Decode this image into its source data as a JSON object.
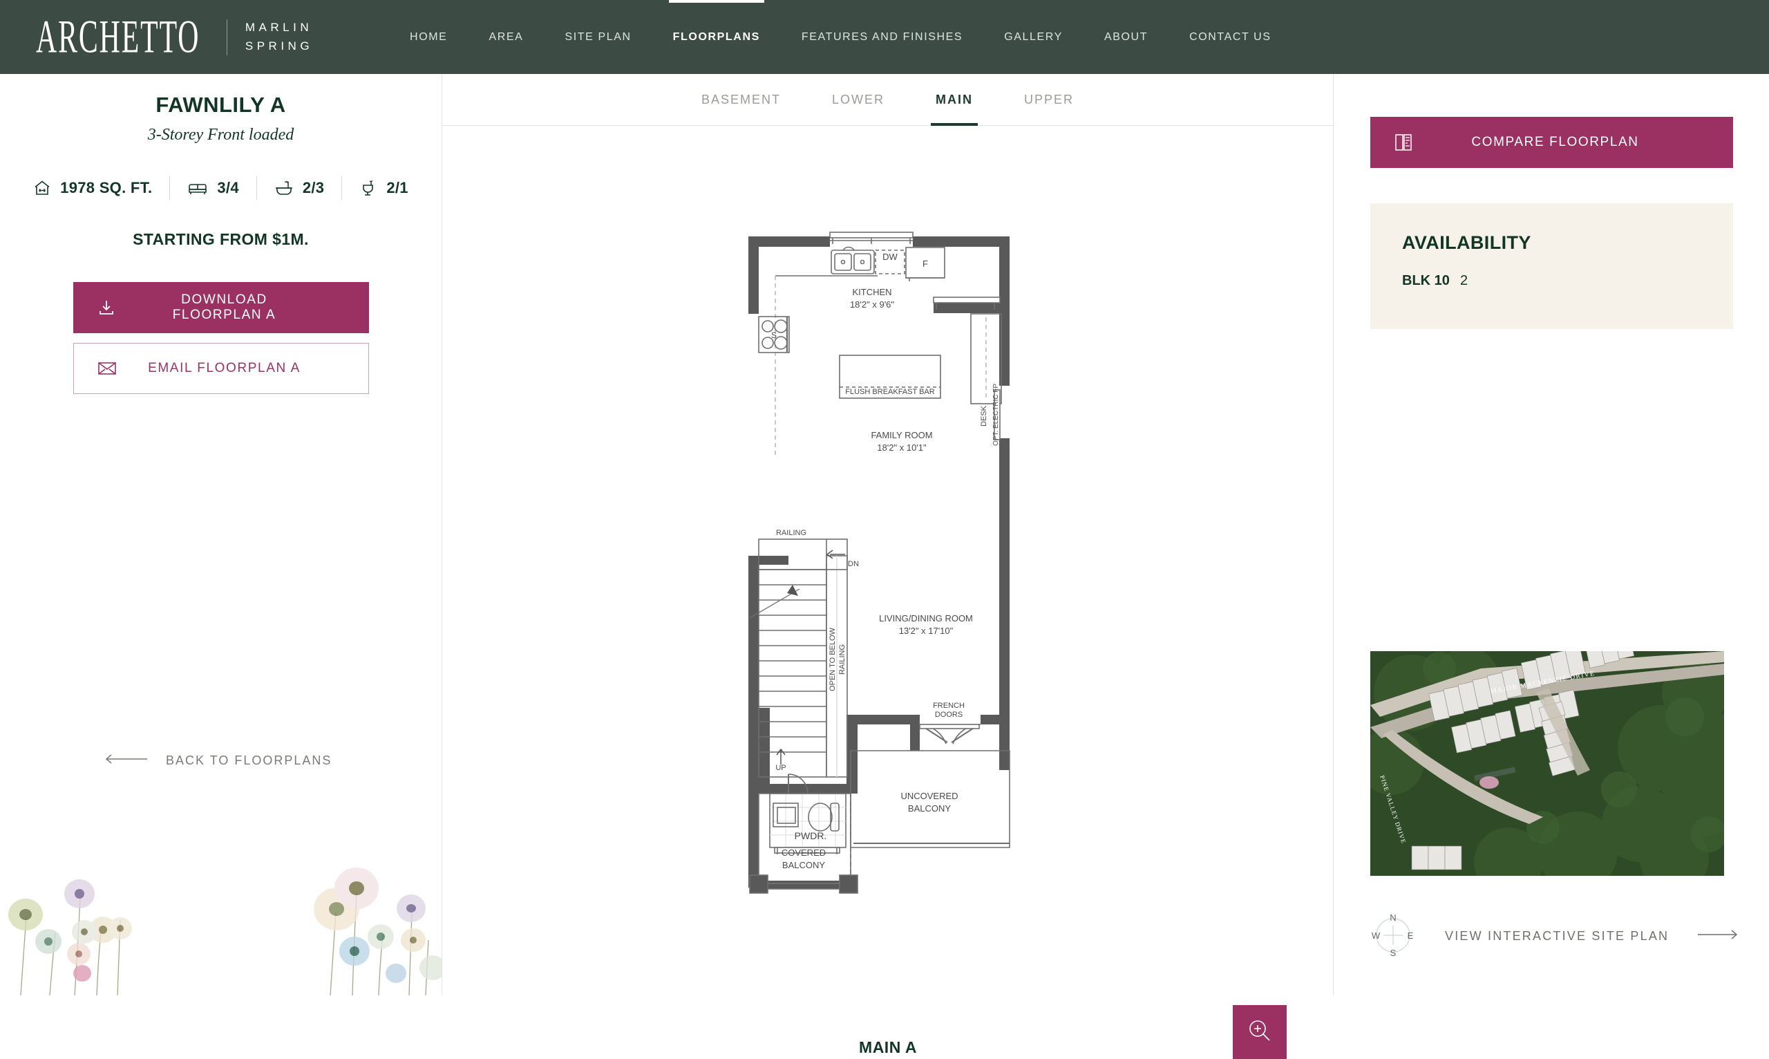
{
  "header": {
    "logo_primary": "ARCHETTO",
    "logo_secondary_line1": "MARLIN",
    "logo_secondary_line2": "SPRING",
    "nav": [
      {
        "label": "HOME",
        "active": false
      },
      {
        "label": "AREA",
        "active": false
      },
      {
        "label": "SITE PLAN",
        "active": false
      },
      {
        "label": "FLOORPLANS",
        "active": true
      },
      {
        "label": "FEATURES AND FINISHES",
        "active": false
      },
      {
        "label": "GALLERY",
        "active": false
      },
      {
        "label": "ABOUT",
        "active": false
      },
      {
        "label": "CONTACT US",
        "active": false
      }
    ]
  },
  "sidebar": {
    "plan_title": "FAWNLILY A",
    "plan_subtitle": "3-Storey Front loaded",
    "specs": [
      {
        "icon": "home-size-icon",
        "value": "1978 SQ. FT."
      },
      {
        "icon": "bed-icon",
        "value": "3/4"
      },
      {
        "icon": "bathtub-icon",
        "value": "2/3"
      },
      {
        "icon": "toilet-icon",
        "value": "2/1"
      }
    ],
    "price": "STARTING FROM $1M.",
    "download_label": "DOWNLOAD FLOORPLAN A",
    "email_label": "EMAIL FLOORPLAN A",
    "back_label": "BACK TO FLOORPLANS"
  },
  "floor_tabs": [
    {
      "label": "BASEMENT",
      "active": false
    },
    {
      "label": "LOWER",
      "active": false
    },
    {
      "label": "MAIN",
      "active": true
    },
    {
      "label": "UPPER",
      "active": false
    }
  ],
  "plan_caption": "MAIN A",
  "zoom_button": {
    "icon": "magnifier-plus-icon"
  },
  "floorplan": {
    "rooms": [
      {
        "name": "KITCHEN",
        "dims": "18'2\" x 9'6\""
      },
      {
        "name": "FAMILY ROOM",
        "dims": "18'2\" x 10'1\""
      },
      {
        "name": "LIVING/DINING ROOM",
        "dims": "13'2\" x 17'10\""
      },
      {
        "name": "PWDR.",
        "dims": ""
      },
      {
        "name": "COVERED BALCONY",
        "dims": ""
      },
      {
        "name": "UNCOVERED BALCONY",
        "dims": ""
      }
    ],
    "labels": {
      "dishwasher": "DW",
      "fridge": "F",
      "stove": "S",
      "desk": "DESK",
      "breakfast_bar": "FLUSH BREAKFAST BAR",
      "fireplace": "OPT. ELECTRIC FP",
      "railing": "RAILING",
      "railing2": "RAILING",
      "open_to_below": "OPEN TO BELOW",
      "stair_down": "DN",
      "stair_up": "UP",
      "french_doors_l1": "FRENCH",
      "french_doors_l2": "DOORS",
      "powder": "PWDR.",
      "covered_l1": "COVERED",
      "covered_l2": "BALCONY",
      "uncovered_l1": "UNCOVERED",
      "uncovered_l2": "BALCONY",
      "kitchen_name": "KITCHEN",
      "kitchen_dims": "18'2\" x 9'6\"",
      "family_name": "FAMILY ROOM",
      "family_dims": "18'2\" x 10'1\"",
      "living_name": "LIVING/DINING ROOM",
      "living_dims": "13'2\" x 17'10\""
    }
  },
  "right_panel": {
    "compare_label": "COMPARE FLOORPLAN",
    "compare_icon": "compare-floorplan-icon",
    "availability_heading": "AVAILABILITY",
    "availability_rows": [
      {
        "block": "BLK 10",
        "count": "2"
      }
    ],
    "site_plan_label": "VIEW INTERACTIVE SITE PLAN",
    "compass": {
      "n": "N",
      "e": "E",
      "s": "S",
      "w": "W"
    },
    "aerial_roads": [
      "MAJOR MACKENZIE DRIVE",
      "PINE VALLEY DRIVE"
    ]
  },
  "colors": {
    "header_green": "#3c4c44",
    "accent_magenta": "#9b3163",
    "dark_green_text": "#123626",
    "availability_bg": "#f6f1e9"
  }
}
